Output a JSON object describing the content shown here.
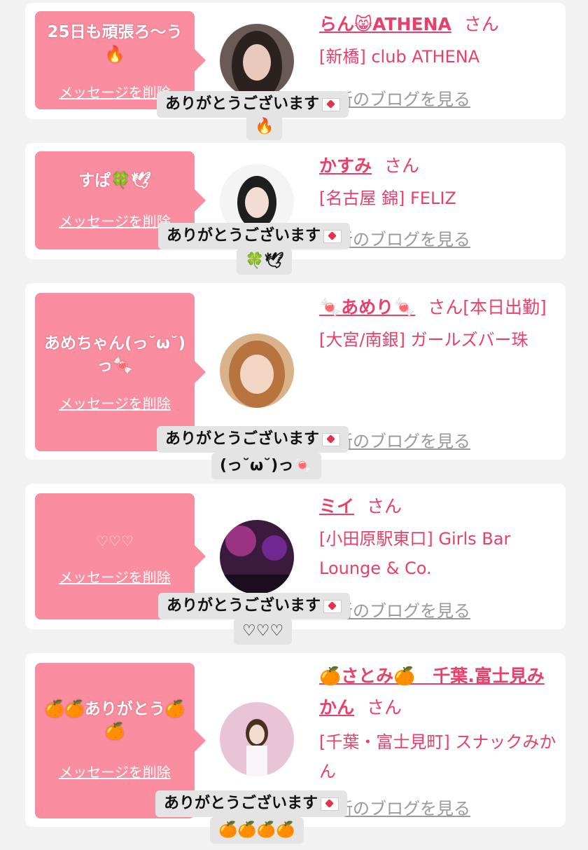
{
  "delete_label": "メッセージを削除",
  "blog_label": "最新のブログを見る",
  "san_label": "さん",
  "cards": [
    {
      "message": "25日も頑張ろ〜う🔥",
      "name": "らん😸ATHENA",
      "shop": "[新橋] club ATHENA",
      "thanks": "ありがとうございます",
      "thanks_extra": "🔥"
    },
    {
      "message": "すぱ🍀🕊",
      "name": "かすみ",
      "shop": "[名古屋 錦] FELIZ",
      "thanks": "ありがとうございます",
      "thanks_extra": "🍀🕊"
    },
    {
      "message": "あめちゃん(っ˘ω˘)っ🍬",
      "name": "🍬あめり🍬",
      "name_suffix": "[本日出勤]",
      "shop": "[大宮/南銀] ガールズバー珠",
      "thanks": "ありがとうございます",
      "thanks_extra": "(っ˘ω˘)っ🍬"
    },
    {
      "message": "♡♡♡",
      "name": "ミイ",
      "shop": "[小田原駅東口] Girls Bar Lounge & Co.",
      "thanks": "ありがとうございます",
      "thanks_extra": "♡♡♡"
    },
    {
      "message": "🍊🍊ありがとう🍊🍊",
      "name": "🍊さとみ🍊　千葉.富士見みかん",
      "shop": "[千葉・富士見町] スナックみかん",
      "thanks": "ありがとうございます",
      "thanks_extra": "🍊🍊🍊🍊"
    }
  ],
  "colors": {
    "accent": "#e8406b",
    "bubble": "#fa8da0",
    "card": "#ffffff",
    "bg": "#f2f2f2"
  }
}
